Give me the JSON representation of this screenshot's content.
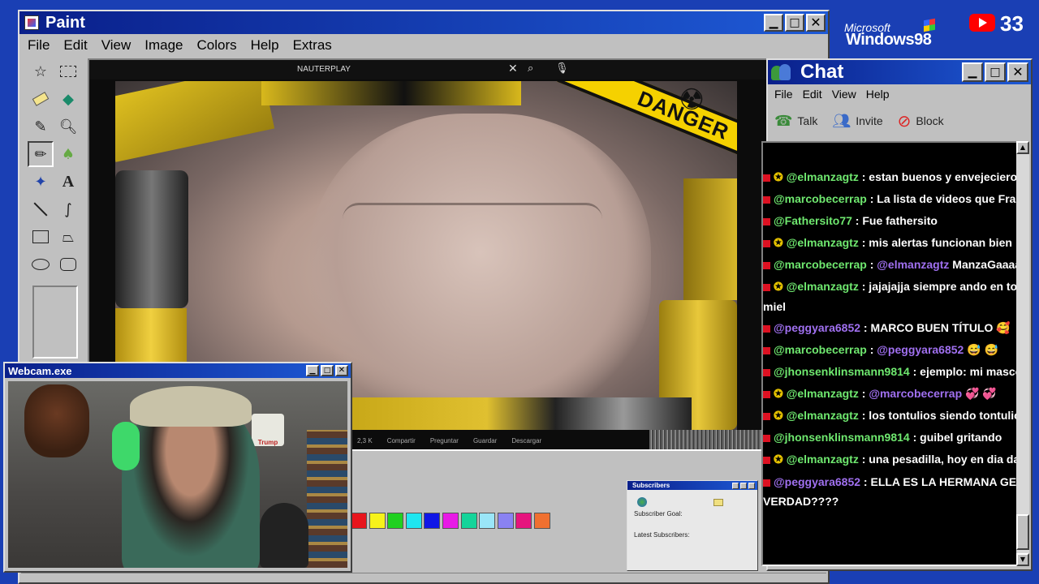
{
  "desktop": {
    "brand_top": "Microsoft",
    "brand_main": "Windows98",
    "yt_count": "33"
  },
  "paint": {
    "title": "Paint",
    "menu": [
      "File",
      "Edit",
      "View",
      "Image",
      "Colors",
      "Help",
      "Extras"
    ],
    "video": {
      "channel": "NAUTERPLAY",
      "sign": "DANGER",
      "actions": [
        "2,3 K",
        "Compartir",
        "Preguntar",
        "Guardar",
        "Descargar"
      ]
    },
    "palette": [
      "#e8141c",
      "#f6f21a",
      "#20d020",
      "#1ee6f0",
      "#1016e6",
      "#e81ae6",
      "#14d49a",
      "#9ae6f8",
      "#8a82f2",
      "#e6147e",
      "#f07030"
    ]
  },
  "webcam": {
    "title": "Webcam.exe",
    "cap_text": "Trump"
  },
  "subscribers": {
    "title": "Subscribers",
    "goal_label": "Subscriber Goal:",
    "latest_label": "Latest Subscribers:"
  },
  "chat": {
    "title": "Chat",
    "menu": [
      "File",
      "Edit",
      "View",
      "Help"
    ],
    "toolbar": [
      "Talk",
      "Invite",
      "Block"
    ],
    "messages": [
      {
        "user": "@elmanzagtz",
        "star": true,
        "color": "#6fe86f",
        "text": " : estan buenos y envejecieron bi"
      },
      {
        "user": "@marcobecerrap",
        "star": false,
        "color": "#6fe86f",
        "text": " : La lista de videos que Frank r"
      },
      {
        "user": "@Fathersito77",
        "star": false,
        "color": "#6fe86f",
        "text": " : Fue fathersito"
      },
      {
        "user": "@elmanzagtz",
        "star": true,
        "color": "#6fe86f",
        "text": " : mis alertas funcionan bien"
      },
      {
        "user": "@marcobecerrap",
        "star": false,
        "color": "#6fe86f",
        "text": " : ",
        "mention": "@elmanzagtz",
        "rest": " ManzaGaaaaac"
      },
      {
        "user": "@elmanzagtz",
        "star": true,
        "color": "#6fe86f",
        "text": " : jajajajja siempre ando en todos"
      },
      {
        "user": "",
        "star": false,
        "color": "#fff",
        "text": "miel",
        "cont": true
      },
      {
        "user": "@peggyara6852",
        "star": false,
        "color": "#a070f0",
        "text": " : MARCO BUEN TÍTULO 🥰"
      },
      {
        "user": "@marcobecerrap",
        "star": false,
        "color": "#6fe86f",
        "text": " : ",
        "mention": "@peggyara6852",
        "rest": " 😅 😅"
      },
      {
        "user": "@jhonsenklinsmann9814",
        "star": false,
        "color": "#6fe86f",
        "text": " : ejemplo: mi mascota"
      },
      {
        "user": "@elmanzagtz",
        "star": true,
        "color": "#6fe86f",
        "text": " : ",
        "mention": "@marcobecerrap",
        "rest": " 💞 💞"
      },
      {
        "user": "@elmanzagtz",
        "star": true,
        "color": "#6fe86f",
        "text": " : los tontulios siendo tontulios"
      },
      {
        "user": "@jhonsenklinsmann9814",
        "star": false,
        "color": "#6fe86f",
        "text": " : guibel gritando"
      },
      {
        "user": "@elmanzagtz",
        "star": true,
        "color": "#6fe86f",
        "text": " : una pesadilla, hoy en dia dalas"
      },
      {
        "user": "@peggyara6852",
        "star": false,
        "color": "#a070f0",
        "text": " : ELLA ES LA HERMANA GEMEL"
      },
      {
        "user": "",
        "star": false,
        "color": "#fff",
        "text": "VERDAD????",
        "cont": true
      }
    ]
  }
}
